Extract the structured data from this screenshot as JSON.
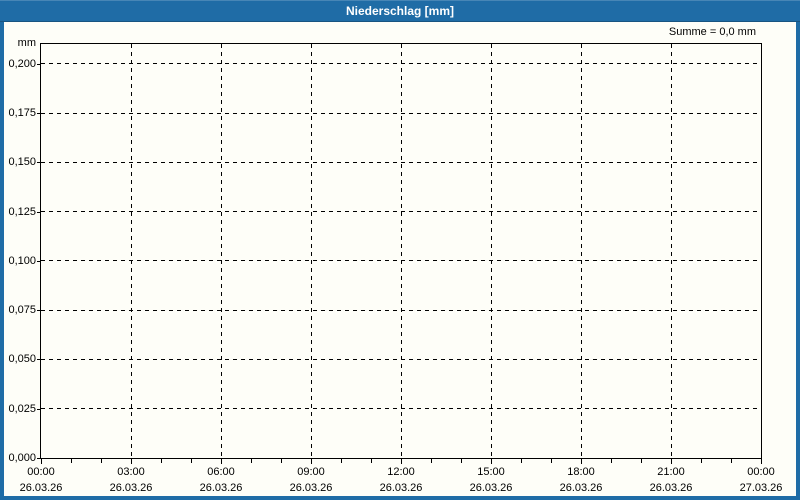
{
  "window": {
    "title": "Niederschlag [mm]"
  },
  "annotation": {
    "sum_label": "Summe = 0,0 mm"
  },
  "chart_data": {
    "type": "line",
    "title": "Niederschlag [mm]",
    "xlabel": "",
    "ylabel": "mm",
    "ylim": [
      0,
      0.21
    ],
    "x_range_hours": [
      0,
      24
    ],
    "grid": true,
    "legend_position": "none",
    "annotation": "Summe = 0,0 mm",
    "y_ticks": [
      {
        "label": "0,200",
        "value": 0.2
      },
      {
        "label": "0,175",
        "value": 0.175
      },
      {
        "label": "0,150",
        "value": 0.15
      },
      {
        "label": "0,125",
        "value": 0.125
      },
      {
        "label": "0,100",
        "value": 0.1
      },
      {
        "label": "0,075",
        "value": 0.075
      },
      {
        "label": "0,050",
        "value": 0.05
      },
      {
        "label": "0,025",
        "value": 0.025
      },
      {
        "label": "0,000",
        "value": 0.0
      }
    ],
    "x_ticks": [
      {
        "hour": 0,
        "time": "00:00",
        "date": "26.03.26"
      },
      {
        "hour": 3,
        "time": "03:00",
        "date": "26.03.26"
      },
      {
        "hour": 6,
        "time": "06:00",
        "date": "26.03.26"
      },
      {
        "hour": 9,
        "time": "09:00",
        "date": "26.03.26"
      },
      {
        "hour": 12,
        "time": "12:00",
        "date": "26.03.26"
      },
      {
        "hour": 15,
        "time": "15:00",
        "date": "26.03.26"
      },
      {
        "hour": 18,
        "time": "18:00",
        "date": "26.03.26"
      },
      {
        "hour": 21,
        "time": "21:00",
        "date": "26.03.26"
      },
      {
        "hour": 24,
        "time": "00:00",
        "date": "27.03.26"
      }
    ],
    "x_minor_tick_step_hours": 1,
    "x_major_tick_step_hours": 3,
    "series": [
      {
        "name": "Niederschlag",
        "unit": "mm",
        "sum_mm": 0.0,
        "values": []
      }
    ]
  },
  "colors": {
    "titlebar": "#1f6ca6",
    "frame": "#1f6ca6",
    "grid": "#000000",
    "plot_border": "#000000",
    "background": "#fefef8",
    "title_text": "#ffffff",
    "label_text": "#000000"
  }
}
